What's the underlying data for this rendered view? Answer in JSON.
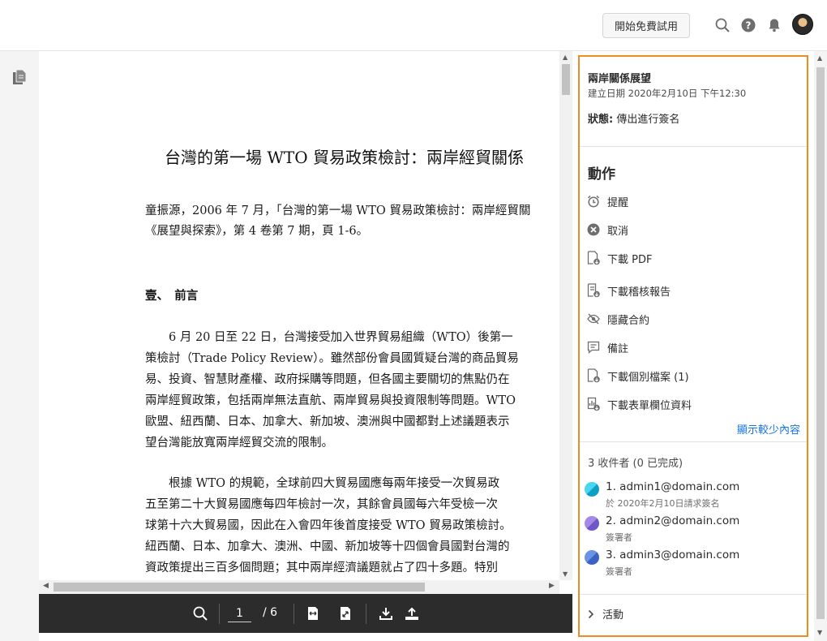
{
  "header": {
    "trial_button": "開始免費試用",
    "icons": [
      "search-icon",
      "help-icon",
      "bell-icon",
      "avatar"
    ]
  },
  "left_rail": {
    "icon": "documents-icon"
  },
  "document": {
    "title": "台灣的第一場 WTO 貿易政策檢討：兩岸經貿關係",
    "lines": [
      "童振源，2006 年 7 月，「台灣的第一場 WTO 貿易政策檢討：兩岸經貿關",
      "《展望與探索》，第 4 卷第 7 期，頁 1-6。",
      "壹、　前言",
      "　　6 月 20 日至 22 日，台灣接受加入世界貿易組織（WTO）後第一",
      "策檢討（Trade Policy Review）。雖然部份會員國質疑台灣的商品貿易",
      "易、投資、智慧財產權、政府採購等問題，但各國主要關切的焦點仍在",
      "兩岸經貿政策，包括兩岸無法直航、兩岸貿易與投資限制等問題。WTO",
      "歐盟、紐西蘭、日本、加拿大、新加坡、澳洲與中國都對上述議題表示",
      "望台灣能放寬兩岸經貿交流的限制。",
      "　　根據 WTO 的規範，全球前四大貿易國應每兩年接受一次貿易政",
      "五至第二十大貿易國應每四年檢討一次，其餘會員國每六年受檢一次",
      "球第十六大貿易國，因此在入會四年後首度接受 WTO 貿易政策檢討。",
      "紐西蘭、日本、加拿大、澳洲、中國、新加坡等十四個會員國對台灣的",
      "資政策提出三百多個問題；其中兩岸經濟議題就占了四十多題。特別"
    ]
  },
  "toolbar": {
    "current_page": "1",
    "total_pages": "/ 6",
    "icons": [
      "search-icon",
      "fit-width-icon",
      "fit-page-icon",
      "download-icon",
      "share-icon"
    ]
  },
  "panel": {
    "agreement_title": "兩岸關係展望",
    "created": "建立日期 2020年2月10日 下午12:30",
    "status_label": "狀態:",
    "status_value": " 傳出進行簽名",
    "actions_heading": "動作",
    "actions": [
      {
        "label": "提醒",
        "icon": "alarm-clock-icon"
      },
      {
        "label": "取消",
        "icon": "cancel-icon"
      },
      {
        "label": "下載 PDF",
        "icon": "download-pdf-icon"
      },
      {
        "label": "下載稽核報告",
        "icon": "audit-report-icon"
      },
      {
        "label": "隱藏合約",
        "icon": "hide-icon"
      },
      {
        "label": "備註",
        "icon": "note-icon"
      },
      {
        "label": "下載個別檔案 (1)",
        "icon": "download-files-icon"
      },
      {
        "label": "下載表單欄位資料",
        "icon": "form-data-icon"
      }
    ],
    "show_less": "顯示較少內容",
    "recipients_heading": "3 收件者 (0 已完成)",
    "recipients": [
      {
        "email": "1. admin1@domain.com",
        "sub": "於 2020年2月10日請求簽名",
        "color": "#1fb5d6"
      },
      {
        "email": "2. admin2@domain.com",
        "sub": "簽署者",
        "color": "#8c6fd8"
      },
      {
        "email": "3. admin3@domain.com",
        "sub": "簽署者",
        "color": "#4a78d6"
      }
    ],
    "activity": "活動"
  },
  "colors": {
    "accent": "#1473e6",
    "panel_border": "#f08a24",
    "toolbar_bg": "#2c2c2c"
  }
}
